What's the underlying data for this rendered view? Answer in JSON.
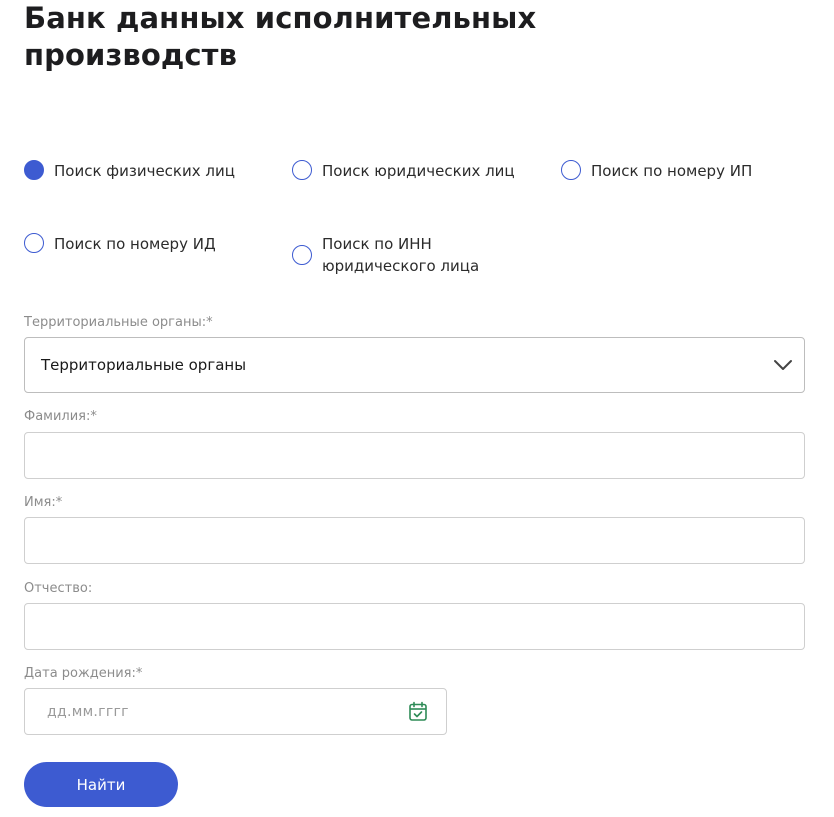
{
  "page": {
    "title": "Банк данных исполнительных производств"
  },
  "search_types": [
    {
      "label": "Поиск физических лиц",
      "checked": true
    },
    {
      "label": "Поиск юридических лиц",
      "checked": false
    },
    {
      "label": "Поиск по номеру ИП",
      "checked": false
    },
    {
      "label": "Поиск по номеру ИД",
      "checked": false
    },
    {
      "label": "Поиск по ИНН юридического лица",
      "checked": false
    }
  ],
  "form": {
    "territorial": {
      "label": "Территориальные органы:*",
      "value": "Территориальные органы"
    },
    "lastname": {
      "label": "Фамилия:*",
      "value": ""
    },
    "firstname": {
      "label": "Имя:*",
      "value": ""
    },
    "patronymic": {
      "label": "Отчество:",
      "value": ""
    },
    "birthdate": {
      "label": "Дата рождения:*",
      "placeholder": "дд.мм.гггг"
    },
    "submit_label": "Найти"
  },
  "colors": {
    "accent": "#3d5bd1",
    "calendar_icon": "#2e8b57"
  }
}
